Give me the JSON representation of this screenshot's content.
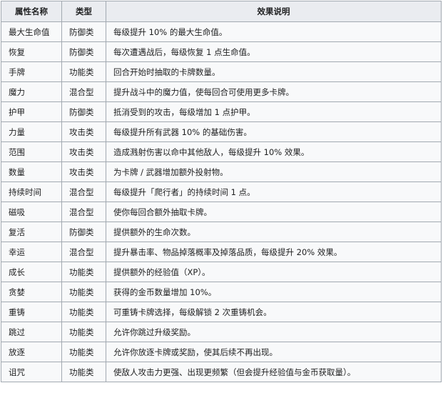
{
  "table": {
    "headers": [
      "属性名称",
      "类型",
      "效果说明"
    ],
    "rows": [
      [
        "最大生命值",
        "防御类",
        "每级提升 10% 的最大生命值。"
      ],
      [
        "恢复",
        "防御类",
        "每次遭遇战后，每级恢复 1 点生命值。"
      ],
      [
        "手牌",
        "功能类",
        "回合开始时抽取的卡牌数量。"
      ],
      [
        "魔力",
        "混合型",
        "提升战斗中的魔力值，使每回合可使用更多卡牌。"
      ],
      [
        "护甲",
        "防御类",
        "抵消受到的攻击，每级增加 1 点护甲。"
      ],
      [
        "力量",
        "攻击类",
        "每级提升所有武器 10% 的基础伤害。"
      ],
      [
        "范围",
        "攻击类",
        "造成溅射伤害以命中其他敌人，每级提升 10% 效果。"
      ],
      [
        "数量",
        "攻击类",
        "为卡牌 / 武器增加额外投射物。"
      ],
      [
        "持续时间",
        "混合型",
        "每级提升「爬行者」的持续时间 1 点。"
      ],
      [
        "磁吸",
        "混合型",
        "使你每回合额外抽取卡牌。"
      ],
      [
        "复活",
        "防御类",
        "提供额外的生命次数。"
      ],
      [
        "幸运",
        "混合型",
        "提升暴击率、物品掉落概率及掉落品质，每级提升 20% 效果。"
      ],
      [
        "成长",
        "功能类",
        "提供额外的经验值（XP）。"
      ],
      [
        "贪婪",
        "功能类",
        "获得的金币数量增加 10%。"
      ],
      [
        "重铸",
        "功能类",
        "可重铸卡牌选择，每级解锁 2 次重铸机会。"
      ],
      [
        "跳过",
        "功能类",
        "允许你跳过升级奖励。"
      ],
      [
        "放逐",
        "功能类",
        "允许你放逐卡牌或奖励，使其后续不再出现。"
      ],
      [
        "诅咒",
        "功能类",
        "使敌人攻击力更强、出现更频繁（但会提升经验值与金币获取量）。"
      ]
    ]
  }
}
